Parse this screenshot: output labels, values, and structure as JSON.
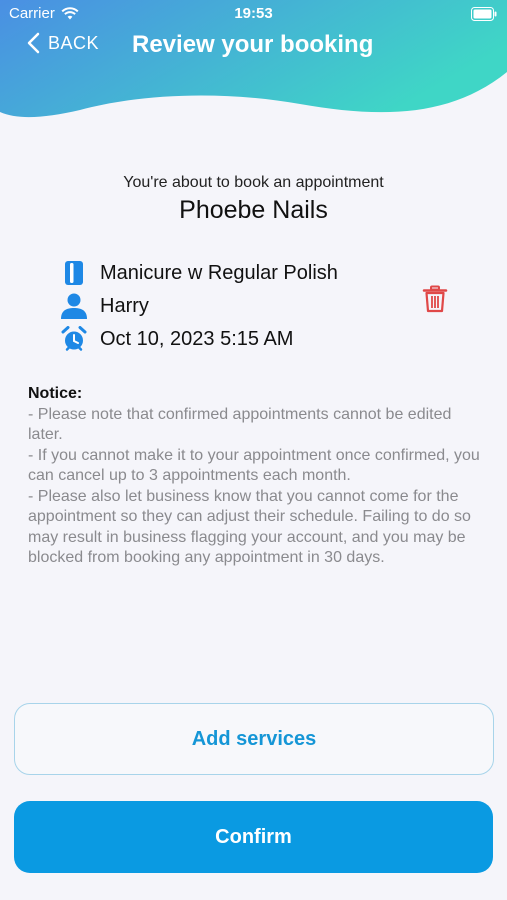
{
  "status_bar": {
    "carrier": "Carrier",
    "time": "19:53"
  },
  "nav": {
    "back_label": "BACK",
    "title": "Review your booking"
  },
  "booking": {
    "intro": "You're about to book an appointment",
    "business_name": "Phoebe Nails",
    "service": "Manicure w Regular Polish",
    "staff": "Harry",
    "datetime": "Oct 10, 2023 5:15 AM"
  },
  "notice": {
    "title": "Notice:",
    "lines": [
      "- Please note that confirmed appointments cannot be edited later.",
      "- If you cannot make it to your appointment once confirmed, you can cancel up to 3 appointments each month.",
      "- Please also let business know that you cannot come for the appointment so they can adjust their schedule. Failing to do so may result in business flagging your account, and you may be blocked from booking any appointment in 30 days."
    ]
  },
  "actions": {
    "add_services": "Add services",
    "confirm": "Confirm"
  },
  "icons": {
    "service": "nail-polish-icon",
    "staff": "person-icon",
    "datetime": "alarm-clock-icon",
    "delete": "trash-icon",
    "back": "chevron-left-icon"
  },
  "colors": {
    "accent": "#0a9ae2",
    "header_gradient_start": "#4a90e2",
    "header_gradient_end": "#3fd4c8",
    "icon_blue": "#1e88e5",
    "delete_red": "#e04848"
  }
}
